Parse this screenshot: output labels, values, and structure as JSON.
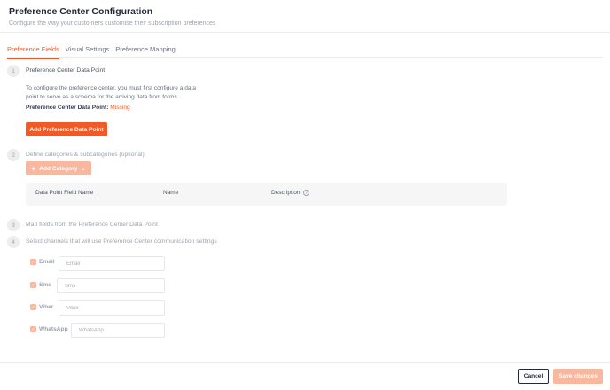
{
  "header": {
    "title": "Preference Center Configuration",
    "subtitle": "Configure the way your customers customise their subscription preferences"
  },
  "tabs": [
    {
      "label": "Preference Fields",
      "active": true
    },
    {
      "label": "Visual Settings",
      "active": false
    },
    {
      "label": "Preference Mapping",
      "active": false
    }
  ],
  "steps": [
    {
      "number": "1",
      "title": "Preference Center Data Point"
    },
    {
      "number": "2",
      "title": "Define categories & subcategories (optional)"
    },
    {
      "number": "3",
      "title": "Map fields from the Preference Center Data Point"
    },
    {
      "number": "4",
      "title": "Select channels that will use Preference Center communication settings"
    }
  ],
  "step1": {
    "description": "To configure the preference center, you must first configure a data point to serve as a schema for the arriving data from forms.",
    "data_point_label": "Preference Center Data Point:",
    "data_point_value": "Missing",
    "add_button": "Add Preference Data Point"
  },
  "step2": {
    "add_category_button": "Add Category",
    "columns": [
      "Data Point Field Name",
      "Name",
      "Description"
    ]
  },
  "channels": [
    {
      "label": "Email",
      "placeholder": "Email",
      "checked": true
    },
    {
      "label": "Sms",
      "placeholder": "Sms",
      "checked": true
    },
    {
      "label": "Viber",
      "placeholder": "Viber",
      "checked": true
    },
    {
      "label": "WhatsApp",
      "placeholder": "WhatsApp",
      "checked": true
    }
  ],
  "footer": {
    "cancel": "Cancel",
    "save": "Save changes"
  },
  "colors": {
    "accent": "#f05a28",
    "accent_disabled": "#f8b79f"
  }
}
